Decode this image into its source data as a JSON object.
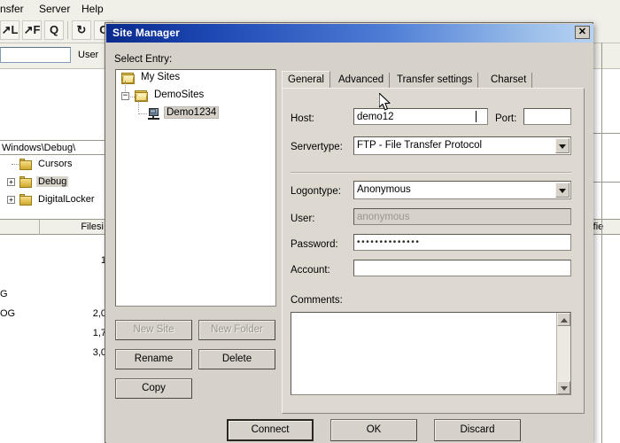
{
  "background_app": {
    "menus": [
      "nsfer",
      "Server",
      "Help"
    ],
    "toolbar_icons": [
      "filter-local-icon",
      "filter-remote-icon",
      "queue-q-icon",
      "refresh-icon",
      "compare-icon"
    ],
    "quickconnect": {
      "host_value": "",
      "user_label": "User"
    },
    "local_path": "Windows\\Debug\\",
    "local_tree": [
      {
        "label": "Cursors",
        "expander": "",
        "selected": false
      },
      {
        "label": "Debug",
        "expander": "+",
        "selected": true
      },
      {
        "label": "DigitalLocker",
        "expander": "+",
        "selected": false
      }
    ],
    "columns": [
      "",
      "Filesi",
      "odifie"
    ],
    "file_rows": [
      {
        "name": "",
        "size": "1"
      },
      {
        "name": "G",
        "size": ""
      },
      {
        "name": "OG",
        "size": "2,0"
      },
      {
        "name": "",
        "size": "1,7"
      },
      {
        "name": "",
        "size": "3,0"
      }
    ]
  },
  "dialog": {
    "title": "Site Manager",
    "close_label": "✕",
    "select_entry_label": "Select Entry:",
    "tree": [
      {
        "label": "My Sites",
        "icon": "folder-icon",
        "depth": 0,
        "expander": "",
        "selected": false
      },
      {
        "label": "DemoSites",
        "icon": "folder-icon",
        "depth": 1,
        "expander": "−",
        "selected": false
      },
      {
        "label": "Demo1234",
        "icon": "server-icon",
        "depth": 2,
        "expander": "",
        "selected": true
      }
    ],
    "left_buttons": [
      {
        "label": "New Site",
        "enabled": false
      },
      {
        "label": "New Folder",
        "enabled": false
      },
      {
        "label": "Rename",
        "enabled": true
      },
      {
        "label": "Delete",
        "enabled": true
      },
      {
        "label": "Copy",
        "enabled": true
      }
    ],
    "tabs": [
      {
        "label": "General",
        "active": true
      },
      {
        "label": "Advanced",
        "active": false
      },
      {
        "label": "Transfer settings",
        "active": false
      },
      {
        "label": "Charset",
        "active": false
      }
    ],
    "general": {
      "host_label": "Host:",
      "host_value": "demo12",
      "port_label": "Port:",
      "port_value": "",
      "servertype_label": "Servertype:",
      "servertype_value": "FTP - File Transfer Protocol",
      "logontype_label": "Logontype:",
      "logontype_value": "Anonymous",
      "user_label": "User:",
      "user_value": "anonymous",
      "user_readonly": true,
      "password_label": "Password:",
      "password_value": "••••••••••••••",
      "account_label": "Account:",
      "account_value": "",
      "comments_label": "Comments:",
      "comments_value": ""
    },
    "bottom_buttons": [
      {
        "label": "Connect",
        "default": true
      },
      {
        "label": "OK",
        "default": false
      },
      {
        "label": "Discard",
        "default": false
      }
    ]
  },
  "colors": {
    "title_gradient_start": "#0a2a8c",
    "title_gradient_end": "#b7d2f2",
    "dialog_face": "#d6d2ca",
    "tabpage_face": "#ddd9d1",
    "field_bg": "#ffffff",
    "disabled_text": "#9b978f",
    "selection_bg": "#d4d0c8",
    "folder_yellow": "#e3c253"
  }
}
